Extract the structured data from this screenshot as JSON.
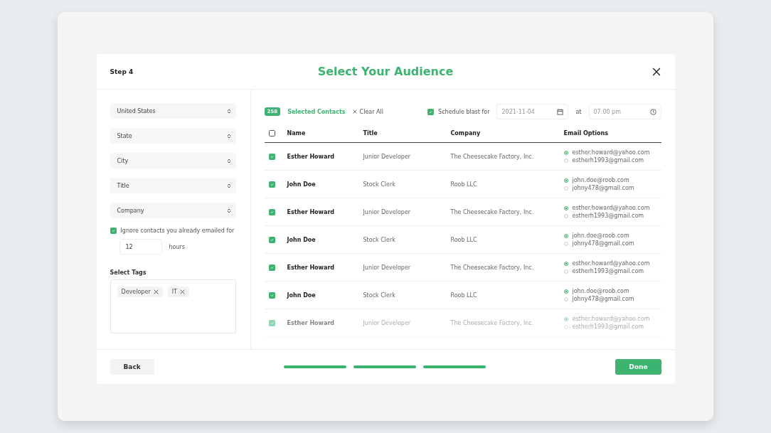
{
  "dialog": {
    "step": "Step 4",
    "title": "Select Your Audience"
  },
  "filters": [
    {
      "value": "United States"
    },
    {
      "value": "State"
    },
    {
      "value": "City"
    },
    {
      "value": "Title"
    },
    {
      "value": "Company"
    }
  ],
  "ignore": {
    "checked": true,
    "label": "Ignore contacts you already emailed for",
    "hours": "12",
    "unit": "hours"
  },
  "tags": {
    "label": "Select Tags",
    "items": [
      "Developer",
      "IT"
    ]
  },
  "toolbar": {
    "count": "258",
    "count_label": "Selected Contacts",
    "clear": "Clear All",
    "schedule": {
      "checked": true,
      "label": "Schedule blast for",
      "date": "2021-11-04",
      "at": "at",
      "time": "07:00 pm"
    }
  },
  "table": {
    "all_checked": false,
    "columns": [
      "Name",
      "Title",
      "Company",
      "Email Options"
    ],
    "rows": [
      {
        "checked": true,
        "name": "Esther Howard",
        "title": "Junior Developer",
        "company": "The Cheesecake Factory, Inc.",
        "emails": [
          {
            "address": "esther.howard@yahoo.com",
            "selected": true
          },
          {
            "address": "estherh1993@gmail.com",
            "selected": false
          }
        ]
      },
      {
        "checked": true,
        "name": "John Doe",
        "title": "Stock Clerk",
        "company": "Roob LLC",
        "emails": [
          {
            "address": "john.doe@roob.com",
            "selected": true
          },
          {
            "address": "johny478@gmail.com",
            "selected": false
          }
        ]
      },
      {
        "checked": true,
        "name": "Esther Howard",
        "title": "Junior Developer",
        "company": "The Cheesecake Factory, Inc.",
        "emails": [
          {
            "address": "esther.howard@yahoo.com",
            "selected": true
          },
          {
            "address": "estherh1993@gmail.com",
            "selected": false
          }
        ]
      },
      {
        "checked": true,
        "name": "John Doe",
        "title": "Stock Clerk",
        "company": "Roob LLC",
        "emails": [
          {
            "address": "john.doe@roob.com",
            "selected": true
          },
          {
            "address": "johny478@gmail.com",
            "selected": false
          }
        ]
      },
      {
        "checked": true,
        "name": "Esther Howard",
        "title": "Junior Developer",
        "company": "The Cheesecake Factory, Inc.",
        "emails": [
          {
            "address": "esther.howard@yahoo.com",
            "selected": true
          },
          {
            "address": "estherh1993@gmail.com",
            "selected": false
          }
        ]
      },
      {
        "checked": true,
        "name": "John Doe",
        "title": "Stock Clerk",
        "company": "Roob LLC",
        "emails": [
          {
            "address": "john.doe@roob.com",
            "selected": true
          },
          {
            "address": "johny478@gmail.com",
            "selected": false
          }
        ]
      },
      {
        "checked": true,
        "name": "Esther Howard",
        "title": "Junior Developer",
        "company": "The Cheesecake Factory, Inc.",
        "emails": [
          {
            "address": "esther.howard@yahoo.com",
            "selected": true
          },
          {
            "address": "estherh1993@gmail.com",
            "selected": false
          }
        ]
      }
    ]
  },
  "footer": {
    "back": "Back",
    "steps": [
      {
        "done": true
      },
      {
        "done": true
      },
      {
        "done": true
      }
    ],
    "done": "Done"
  }
}
